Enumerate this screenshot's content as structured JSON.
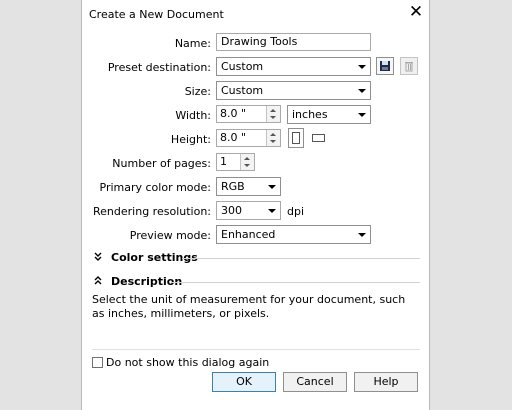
{
  "dialog": {
    "title": "Create a New Document",
    "close_glyph": "✕"
  },
  "fields": {
    "name_label": "Name:",
    "name_value": "Drawing Tools",
    "preset_label": "Preset destination:",
    "preset_value": "Custom",
    "size_label": "Size:",
    "size_value": "Custom",
    "width_label": "Width:",
    "width_value": "8.0 \"",
    "units_value": "inches",
    "height_label": "Height:",
    "height_value": "8.0 \"",
    "pages_label": "Number of pages:",
    "pages_value": "1",
    "color_mode_label": "Primary color mode:",
    "color_mode_value": "RGB",
    "resolution_label": "Rendering resolution:",
    "resolution_value": "300",
    "resolution_unit": "dpi",
    "preview_label": "Preview mode:",
    "preview_value": "Enhanced"
  },
  "sections": {
    "color_settings": "Color settings",
    "description": "Description",
    "description_text": "Select the unit of measurement for your document, such as inches, millimeters, or pixels."
  },
  "footer": {
    "checkbox_label": "Do not show this dialog again",
    "ok": "OK",
    "cancel": "Cancel",
    "help": "Help"
  },
  "icons": {
    "save_preset": "save-icon",
    "delete_preset": "trash-icon",
    "portrait": "portrait-page-icon",
    "landscape": "landscape-page-icon",
    "expand": "chevron-double-down-icon",
    "collapse": "chevron-double-up-icon"
  }
}
